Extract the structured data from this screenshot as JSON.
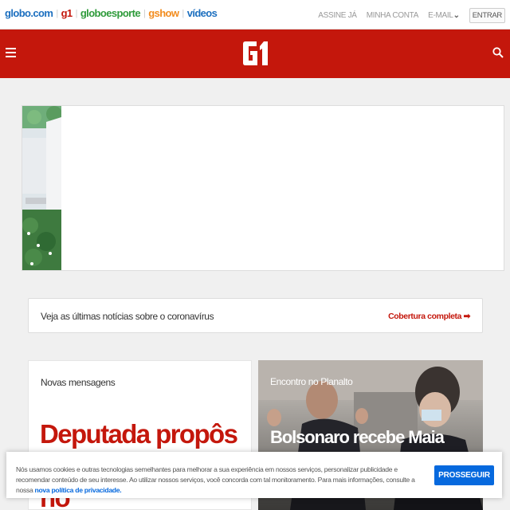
{
  "topbar": {
    "brands": [
      {
        "label": "globo.com",
        "color": "#1c6fbf"
      },
      {
        "label": "g1",
        "color": "#c4170c"
      },
      {
        "label": "globoesporte",
        "color": "#2f9b3b"
      },
      {
        "label": "gshow",
        "color": "#f28c1e"
      },
      {
        "label": "vídeos",
        "color": "#1c6fbf"
      }
    ],
    "links": [
      "ASSINE JÁ",
      "MINHA CONTA",
      "E-MAIL"
    ],
    "entrar": "ENTRAR",
    "email_caret": "⌄"
  },
  "header": {
    "logo_text": "G1",
    "bg_color": "#c4170c"
  },
  "covid": {
    "text": "Veja as últimas notícias sobre o coronavírus",
    "cta": "Cobertura completa ➡"
  },
  "card_left": {
    "kicker": "Novas mensagens",
    "headline": "Deputada propôs a Bolsonaro vaga no"
  },
  "card_right": {
    "kicker": "Encontro no Planalto",
    "headline": "Bolsonaro recebe Maia após"
  },
  "cookie": {
    "text": "Nós usamos cookies e outras tecnologias semelhantes para melhorar a sua experiência em nossos serviços, personalizar publicidade e recomendar conteúdo de seu interesse. Ao utilizar nossos serviços, você concorda com tal monitoramento. Para mais informações, consulte a nossa ",
    "link": "nova política de privacidade.",
    "button": "PROSSEGUIR"
  }
}
